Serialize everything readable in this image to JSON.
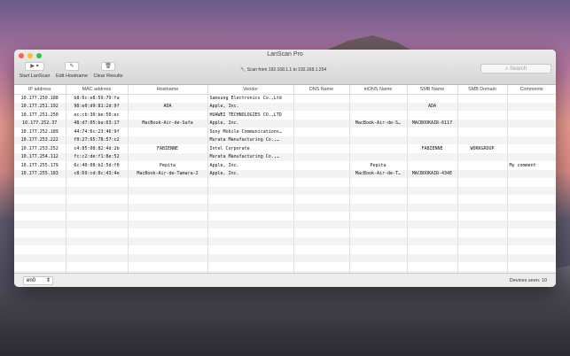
{
  "window": {
    "title": "LanScan Pro"
  },
  "toolbar": {
    "start_label": "Start LanScan",
    "edit_label": "Edit Hostname",
    "clear_label": "Clear Results",
    "scan_range": "Scan from 192.168.1.1 to 192.168.1.254",
    "search_placeholder": "Search"
  },
  "table": {
    "columns": [
      "IP address",
      "MAC address",
      "Hostname",
      "Vendor",
      "DNS Name",
      "mDNS Name",
      "SMB Name",
      "SMB Domain",
      "Comments"
    ],
    "rows": [
      [
        "10.177.250.188",
        "b8:6c:e8:59:79:fa",
        "",
        "Samsung Electronics Co.,Ltd",
        "",
        "",
        "",
        "",
        ""
      ],
      [
        "10.177.251.192",
        "98:e0:d9:81:2d:9f",
        "ADA",
        "Apple, Inc.",
        "",
        "",
        "ADA",
        "",
        ""
      ],
      [
        "10.177.251.250",
        "ec:cb:30:be:50:ec",
        "",
        "HUAWEI TECHNOLOGIES CO.,LTD",
        "",
        "",
        "",
        "",
        ""
      ],
      [
        "10.177.252.37",
        "48:d7:05:ba:63:17",
        "MacBook-Air-de-Safa",
        "Apple, Inc.",
        "",
        "MacBook-Air-de-S…",
        "MACBOOKAIR-6117",
        "",
        ""
      ],
      [
        "10.177.252.189",
        "44:74:6c:23:46:9f",
        "",
        "Sony Mobile Communications…",
        "",
        "",
        "",
        "",
        ""
      ],
      [
        "10.177.253.222",
        "f0:27:65:78:57:c2",
        "",
        "Murata Manufacturing Co.,…",
        "",
        "",
        "",
        "",
        ""
      ],
      [
        "10.177.253.252",
        "c4:85:08:82:4d:2b",
        "FABIENNE",
        "Intel Corporate",
        "",
        "",
        "FABIENNE",
        "WORKGROUP",
        ""
      ],
      [
        "10.177.254.112",
        "fc:c2:de:f1:8e:52",
        "",
        "Murata Manufacturing Co.,…",
        "",
        "",
        "",
        "",
        ""
      ],
      [
        "10.177.255.179",
        "6c:40:08:b2:5d:f0",
        "Pepita",
        "Apple, Inc.",
        "",
        "Pepita",
        "",
        "",
        "My comment"
      ],
      [
        "10.177.255.183",
        "c8:69:cd:8c:43:4e",
        "MacBook-Air-de-Tamara-2",
        "Apple, Inc.",
        "",
        "MacBook-Air-de-T…",
        "MACBOOKAIR-434E",
        "",
        ""
      ]
    ]
  },
  "footer": {
    "interface": "en0",
    "devices_seen": "Devices seen: 10"
  }
}
